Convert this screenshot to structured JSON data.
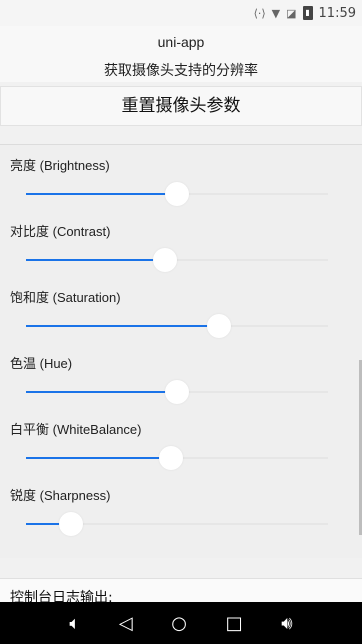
{
  "status_bar": {
    "time": "11:59",
    "battery_icon": "battery-icon",
    "wifi_icon": "wifi-icon",
    "signal_icon": "signal-icon"
  },
  "title_bar": {
    "app_name": "uni-app",
    "page_title": "获取摄像头支持的分辨率"
  },
  "reset_button_label": "重置摄像头参数",
  "sliders": [
    {
      "label": "亮度 (Brightness)",
      "value": 0.5
    },
    {
      "label": "对比度 (Contrast)",
      "value": 0.46
    },
    {
      "label": "饱和度 (Saturation)",
      "value": 0.64
    },
    {
      "label": "色温 (Hue)",
      "value": 0.5
    },
    {
      "label": "白平衡 (WhiteBalance)",
      "value": 0.48
    },
    {
      "label": "锐度 (Sharpness)",
      "value": 0.15
    }
  ],
  "console": {
    "title": "控制台日志输出:"
  },
  "nav_bar": {
    "icons": [
      "volume-down-icon",
      "back-icon",
      "home-icon",
      "recents-icon",
      "volume-up-icon"
    ]
  },
  "colors": {
    "accent": "#1a73e8",
    "nav_background": "#000000"
  }
}
